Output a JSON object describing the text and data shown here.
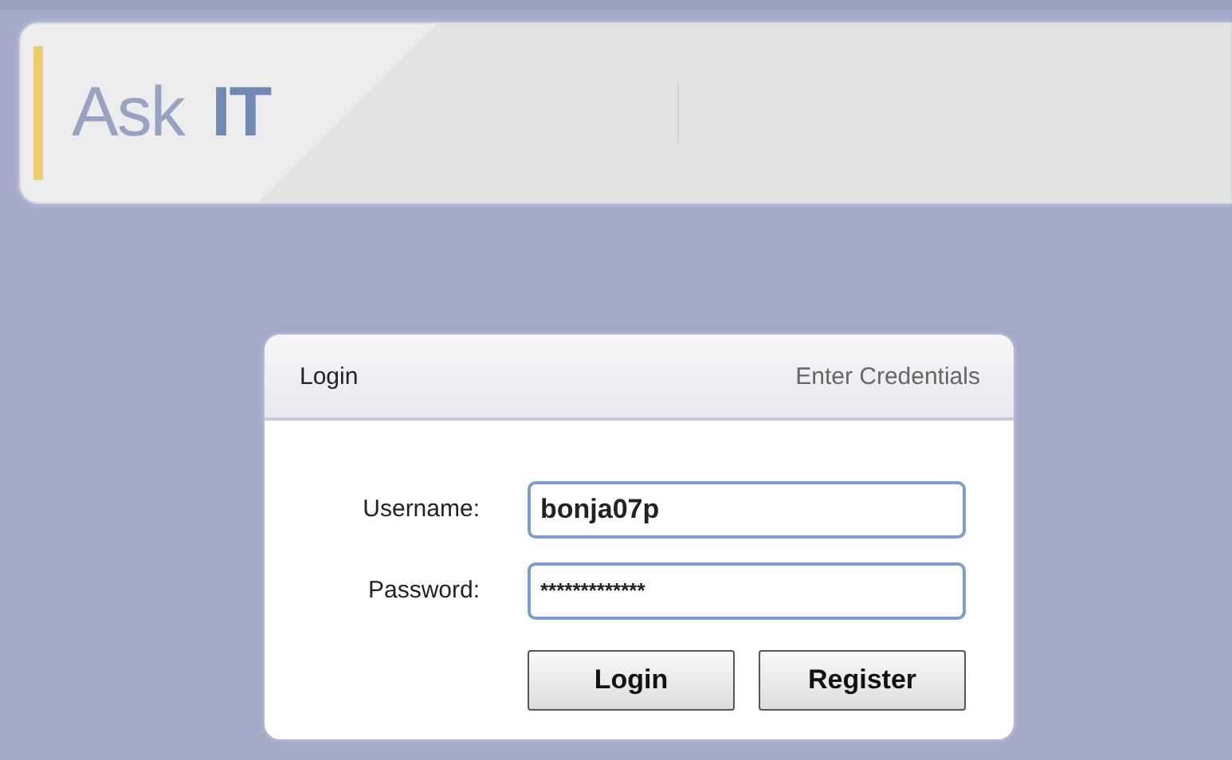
{
  "header": {
    "logo": "Ask **IT**"
  },
  "login_panel": {
    "title": "Login",
    "subtitle": "Enter Credentials",
    "fields": [
      {
        "label": "Username:",
        "value": "bonja07p"
      },
      {
        "label": "Password:",
        "value": "*************"
      }
    ],
    "buttons": [
      "Login",
      "Register"
    ]
  }
}
